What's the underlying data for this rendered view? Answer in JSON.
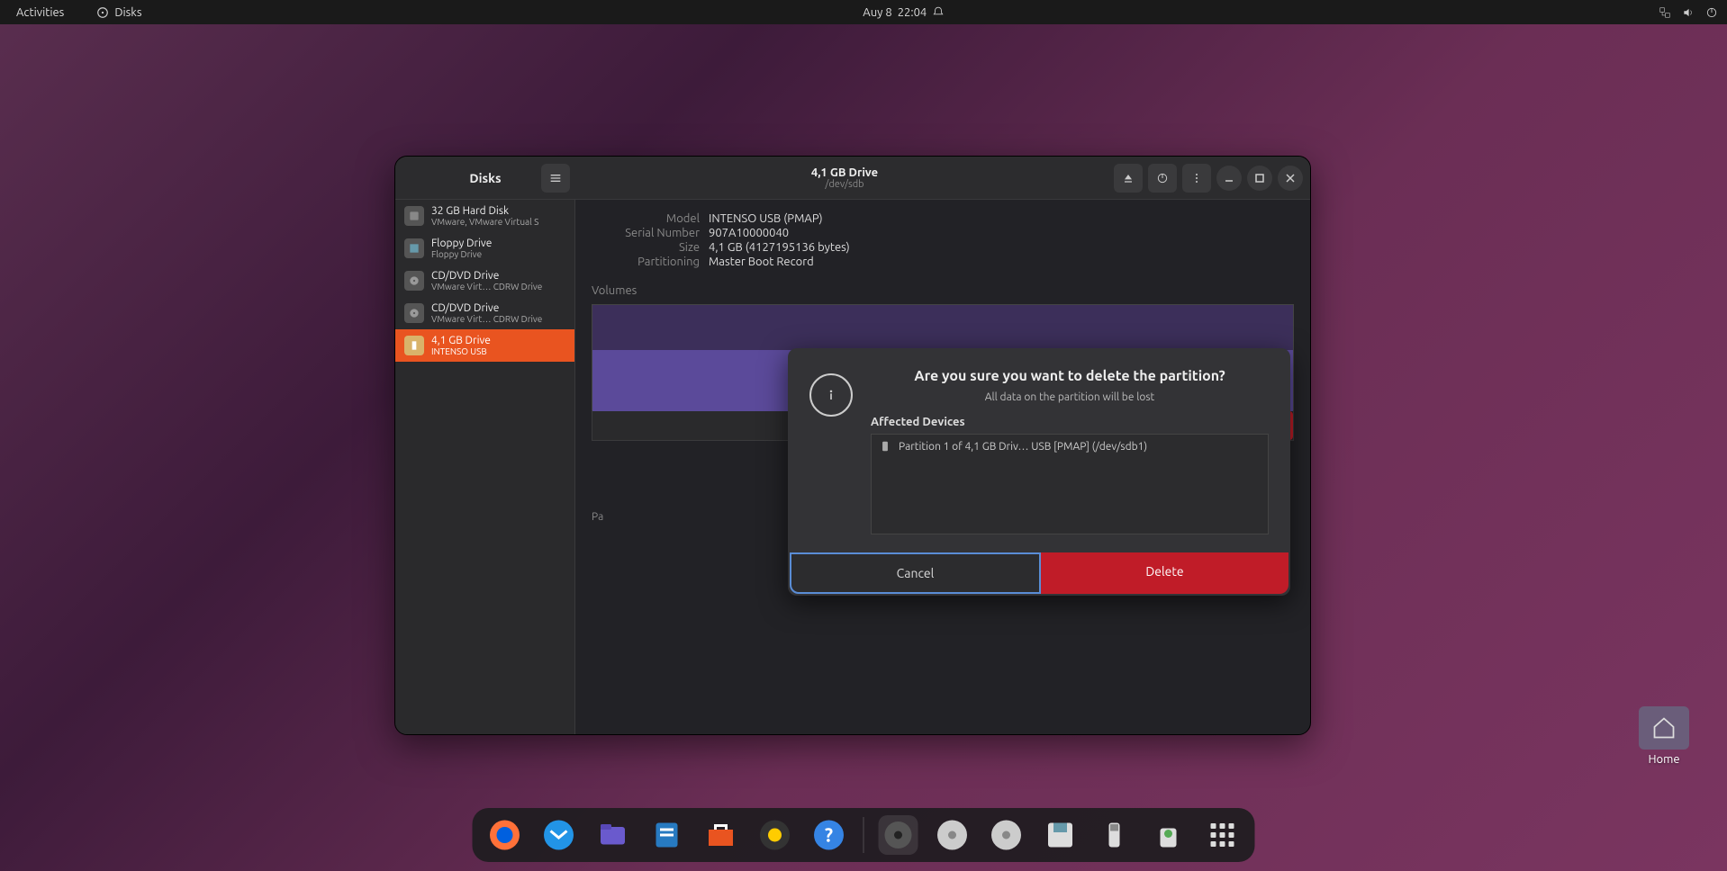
{
  "topbar": {
    "activities": "Activities",
    "app_name": "Disks",
    "date": "Auy 8",
    "time": "22:04"
  },
  "desktop": {
    "home_label": "Home"
  },
  "window": {
    "app_title": "Disks",
    "title": "4,1 GB Drive",
    "subtitle": "/dev/sdb"
  },
  "sidebar": {
    "items": [
      {
        "l1": "32 GB Hard Disk",
        "l2": "VMware, VMware Virtual S"
      },
      {
        "l1": "Floppy Drive",
        "l2": "Floppy Drive"
      },
      {
        "l1": "CD/DVD Drive",
        "l2": "VMware Virt…    CDRW Drive"
      },
      {
        "l1": "CD/DVD Drive",
        "l2": "VMware Virt…    CDRW Drive"
      },
      {
        "l1": "4,1 GB Drive",
        "l2": "INTENSO USB"
      }
    ]
  },
  "details": {
    "model_label": "Model",
    "model_value": "INTENSO USB (PMAP)",
    "serial_label": "Serial Number",
    "serial_value": "907A10000040",
    "size_label": "Size",
    "size_value": "4,1 GB (4127195136 bytes)",
    "partitioning_label": "Partitioning",
    "partitioning_value": "Master Boot Record",
    "volumes_header": "Volumes",
    "partition_label_prefix": "Pa"
  },
  "dialog": {
    "title": "Are you sure you want to delete the partition?",
    "subtitle": "All data on the partition will be lost",
    "affected_header": "Affected Devices",
    "device_text": "Partition 1 of 4,1 GB Driv…   USB [PMAP] (/dev/sdb1)",
    "cancel": "Cancel",
    "delete": "Delete"
  }
}
